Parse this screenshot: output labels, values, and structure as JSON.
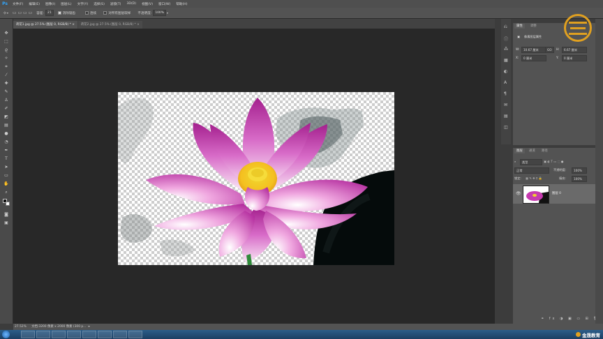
{
  "app": {
    "logo": "Ps"
  },
  "menu": [
    "文件(F)",
    "编辑(E)",
    "图像(I)",
    "图层(L)",
    "文字(Y)",
    "选择(S)",
    "滤镜(T)",
    "3D(D)",
    "视图(V)",
    "窗口(W)",
    "帮助(H)"
  ],
  "options": {
    "tolerance_label": "容差:",
    "tolerance_value": "21",
    "antialias_label": "消除锯齿",
    "contiguous_label": "连续",
    "sample_all_label": "对所有图层取样",
    "opacity_label": "不透明度:",
    "opacity_value": "100%"
  },
  "tabs": [
    {
      "label": "荷花1.jpg @ 27.5% (图层 0, RGB/8) *",
      "active": true
    },
    {
      "label": "荷花2.jpg @ 27.5% (图层 0, RGB/8) *",
      "active": false
    }
  ],
  "properties_panel": {
    "tabs": [
      "属性",
      "调整"
    ],
    "title": "像素图层属性",
    "w_label": "W:",
    "w_value": "10.67 厘米",
    "link_label": "GO",
    "h_label": "H:",
    "h_value": "6.67 厘米",
    "x_label": "X:",
    "x_value": "0 厘米",
    "y_label": "Y:",
    "y_value": "0 厘米"
  },
  "layers_panel": {
    "tabs": [
      "图层",
      "通道",
      "路径"
    ],
    "filter_value": "类型",
    "blend_mode": "正常",
    "opacity_label": "不透明度:",
    "opacity_value": "100%",
    "lock_label": "锁定:",
    "fill_label": "填充:",
    "fill_value": "100%",
    "layers": [
      {
        "name": "图层 0",
        "visible": true
      }
    ]
  },
  "status": {
    "zoom": "27.52%",
    "doc_info": "文档:3200 像素 x 2000 像素 (300 p..."
  },
  "brand": {
    "name": "金晟教育"
  },
  "colors": {
    "accent": "#31a8ff",
    "brand_gold": "#e0a020"
  }
}
